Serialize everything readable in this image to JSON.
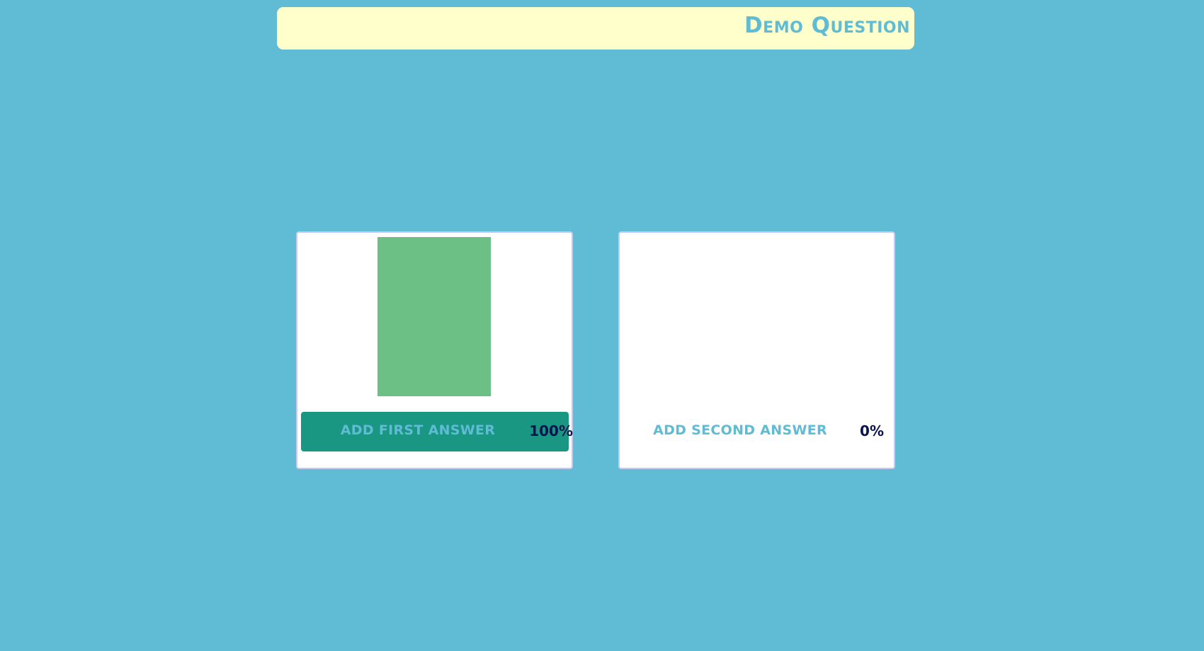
{
  "question": {
    "title": "Demo Question"
  },
  "answers": [
    {
      "label": "add first answer",
      "percent_text": "100%",
      "share": 1.0,
      "selected": true
    },
    {
      "label": "add second answer",
      "percent_text": "0%",
      "share": 0.0,
      "selected": false
    }
  ],
  "colors": {
    "background": "#60bbd4",
    "question_bar": "#ffffcc",
    "accent_text": "#60bbd4",
    "result_bar": "#6cbf85",
    "selected_row": "#1a9782",
    "percent_text": "#0c1450",
    "card_border": "#c7c9f0"
  }
}
